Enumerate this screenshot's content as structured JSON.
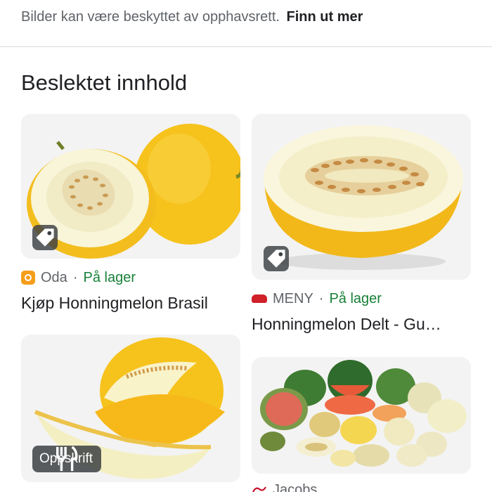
{
  "notice": {
    "text": "Bilder kan være beskyttet av opphavsrett.",
    "link": "Finn ut mer"
  },
  "section": {
    "title": "Beslektet innhold"
  },
  "cards": [
    {
      "badge_icon": "tag-icon",
      "source_icon": "oda-logo-icon",
      "source": "Oda",
      "separator": "·",
      "availability": "På lager",
      "title": "Kjøp Honningmelon Brasil"
    },
    {
      "badge_icon": "tag-icon",
      "source_icon": "meny-logo-icon",
      "source": "MENY",
      "separator": "·",
      "availability": "På lager",
      "title": "Honningmelon Delt - Gu…"
    },
    {
      "badge_icon": "fork-knife-icon",
      "badge_label": "Oppskrift"
    },
    {
      "source_icon": "jacobs-logo-icon",
      "source": "Jacobs"
    }
  ],
  "colors": {
    "in_stock": "#188038",
    "muted_text": "#5f6368",
    "melon_yellow": "#f6c21c",
    "oda_orange": "#f59e1b",
    "meny_red": "#d0202a"
  }
}
